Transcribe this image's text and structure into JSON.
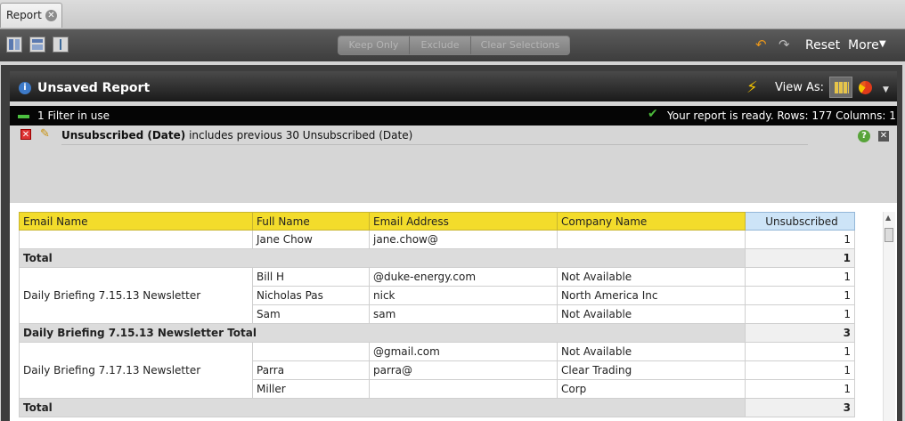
{
  "tab": {
    "label": "Report",
    "close_glyph": "✕"
  },
  "toolbar": {
    "keep_only": "Keep Only",
    "exclude": "Exclude",
    "clear_selections": "Clear Selections",
    "reset": "Reset",
    "more": "More"
  },
  "report": {
    "title": "Unsaved Report",
    "view_as": "View As:",
    "filters_in_use": "1 Filter in use",
    "status": "Your report is ready.  Rows: 177  Columns: 1",
    "filter": {
      "field": "Unsubscribed (Date)",
      "rest": " includes previous 30 Unsubscribed (Date)"
    }
  },
  "table": {
    "headers": [
      "Email Name",
      "Full Name",
      "Email Address",
      "Company Name",
      "Unsubscribed"
    ],
    "rows": [
      {
        "type": "data",
        "email_name": "",
        "full_name": "Jane Chow",
        "email": "jane.chow@",
        "company": "",
        "value": "1"
      },
      {
        "type": "total",
        "label": "Total",
        "value": "1"
      },
      {
        "type": "data",
        "email_name": "Daily Briefing 7.15.13 Newsletter",
        "full_name": "Bill H",
        "email": "@duke-energy.com",
        "company": "Not Available",
        "value": "1"
      },
      {
        "type": "data",
        "email_name": "",
        "full_name": "Nicholas Pas",
        "email": "nick",
        "company": "North America Inc",
        "value": "1"
      },
      {
        "type": "data",
        "email_name": "",
        "full_name": "Sam",
        "email": "sam",
        "company": "Not Available",
        "value": "1"
      },
      {
        "type": "total",
        "label": "Daily Briefing 7.15.13 Newsletter Total",
        "value": "3"
      },
      {
        "type": "data",
        "email_name": "Daily Briefing 7.17.13 Newsletter",
        "full_name": "",
        "email": "@gmail.com",
        "company": "Not Available",
        "value": "1"
      },
      {
        "type": "data",
        "email_name": "",
        "full_name": "Parra",
        "email": "parra@",
        "company": "Clear Trading",
        "value": "1"
      },
      {
        "type": "data",
        "email_name": "",
        "full_name": "Miller",
        "email": "",
        "company": "Corp",
        "value": "1"
      },
      {
        "type": "total",
        "label": "Total",
        "value": "3"
      }
    ]
  }
}
